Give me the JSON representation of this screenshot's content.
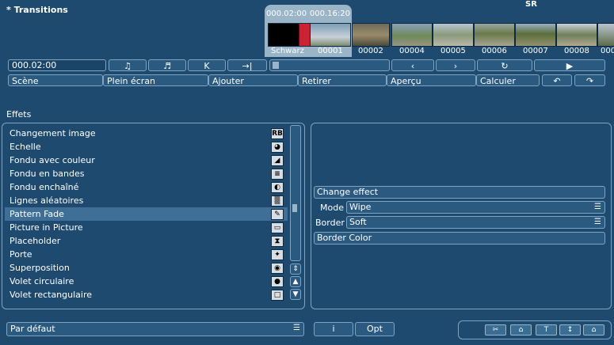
{
  "header": {
    "title": "* Transitions",
    "corner": "SR"
  },
  "filmstrip": {
    "selected": {
      "time_in": "000.02:00",
      "time_out": "000.16:20",
      "left_label": "Schwarz",
      "right_label": "00001"
    },
    "clips": [
      "00002",
      "00004",
      "00005",
      "00006",
      "00007",
      "00008",
      "0000"
    ]
  },
  "controls": {
    "timecode": "000.02:00",
    "row1_symbols": [
      "♫",
      "♬",
      "K",
      "→|",
      "‹",
      "›",
      "↻",
      "▶"
    ],
    "row2": [
      "Scène",
      "Plein écran",
      "Ajouter",
      "Retirer",
      "Aperçu",
      "Calculer"
    ],
    "undo": "↶",
    "redo": "↷"
  },
  "effects": {
    "heading": "Effets",
    "items": [
      {
        "label": "Changement image",
        "icon": "RB"
      },
      {
        "label": "Echelle",
        "icon": "◕"
      },
      {
        "label": "Fondu avec couleur",
        "icon": "◢"
      },
      {
        "label": "Fondu en bandes",
        "icon": "≡"
      },
      {
        "label": "Fondu enchaîné",
        "icon": "◐"
      },
      {
        "label": "Lignes aléatoires",
        "icon": "▒"
      },
      {
        "label": "Pattern Fade",
        "icon": "✎"
      },
      {
        "label": "Picture in Picture",
        "icon": "▭"
      },
      {
        "label": "Placeholder",
        "icon": "⧗"
      },
      {
        "label": "Porte",
        "icon": "✦"
      },
      {
        "label": "Superposition",
        "icon": "◉"
      },
      {
        "label": "Volet circulaire",
        "icon": "●"
      },
      {
        "label": "Volet rectangulaire",
        "icon": "□"
      }
    ],
    "selected_index": 6
  },
  "props": {
    "change_effect": "Change effect",
    "mode_label": "Mode",
    "mode_value": "Wipe",
    "border_label": "Border",
    "border_value": "Soft",
    "border_color": "Border Color"
  },
  "footer": {
    "preset": "Par défaut",
    "info": "i",
    "opt": "Opt",
    "icons": [
      "✂",
      "⌂",
      "T",
      "↕",
      "⌂"
    ]
  }
}
